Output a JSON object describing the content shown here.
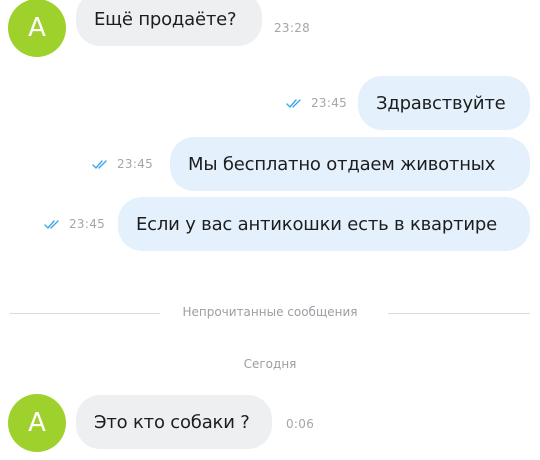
{
  "conversation": {
    "avatar_letter": "A",
    "messages": [
      {
        "direction": "incoming",
        "text": "Ещё продаёте?",
        "time": "23:28"
      },
      {
        "direction": "outgoing",
        "text": "Здравствуйте",
        "time": "23:45",
        "status": "read"
      },
      {
        "direction": "outgoing",
        "text": "Мы бесплатно отдаем животных",
        "time": "23:45",
        "status": "read"
      },
      {
        "direction": "outgoing",
        "text": "Если у вас антикошки есть в квартире",
        "time": "23:45",
        "status": "read"
      }
    ],
    "unread_divider": "Непрочитанные сообщения",
    "date_label": "Сегодня",
    "new_messages": [
      {
        "direction": "incoming",
        "text": "Это кто собаки ?",
        "time": "0:06"
      }
    ]
  },
  "colors": {
    "avatar": "#9fd12c",
    "incoming_bubble": "#eeeff1",
    "outgoing_bubble": "#e4f1fc",
    "read_ticks": "#3ea7e6",
    "meta_text": "#a3a6ab"
  },
  "icons": {
    "read_status": "double-check-icon"
  }
}
